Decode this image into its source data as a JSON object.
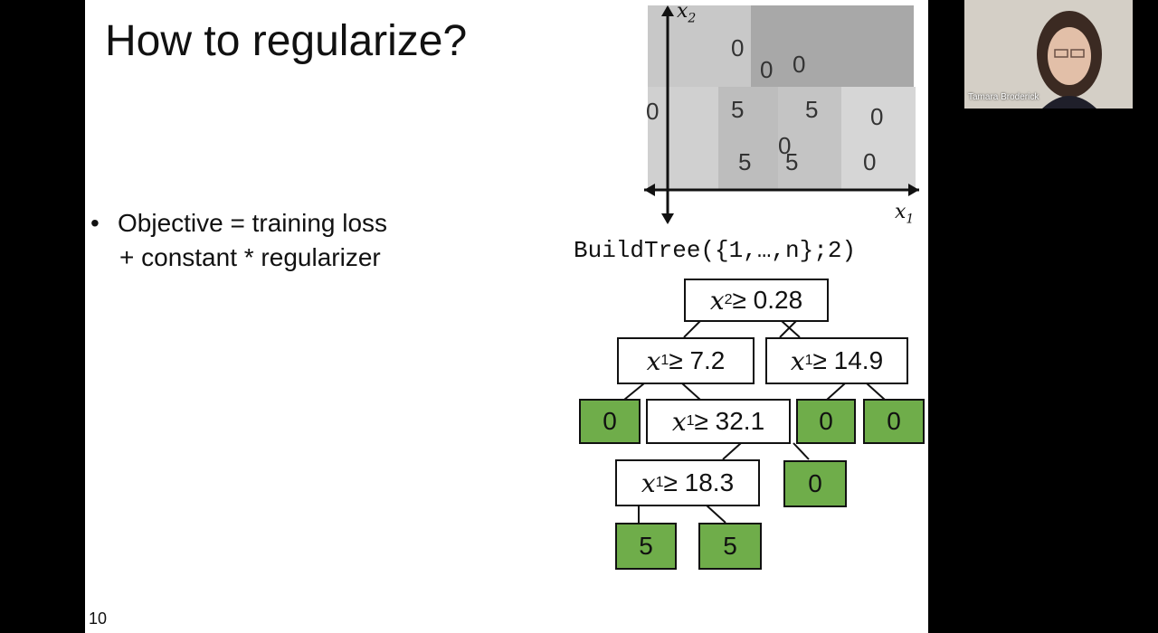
{
  "slide": {
    "title": "How to regularize?",
    "bullet": "•",
    "bullet_line1": "Objective = training loss",
    "bullet_line2": "+ constant * regularizer",
    "page_number": "10"
  },
  "plot": {
    "x_axis_label": "x",
    "x_axis_sub": "1",
    "y_axis_label": "x",
    "y_axis_sub": "2",
    "cells": [
      "0",
      "0",
      "0",
      "0",
      "5",
      "5",
      "0",
      "0",
      "5",
      "5",
      "0"
    ]
  },
  "tree": {
    "call": "BuildTree({1,…,n};2)",
    "root": {
      "var": "x",
      "sub": "2",
      "rest": " ≥ 0.28"
    },
    "n1": {
      "var": "x",
      "sub": "1",
      "rest": " ≥ 7.2"
    },
    "n2": {
      "var": "x",
      "sub": "1",
      "rest": " ≥ 14.9"
    },
    "n3": {
      "var": "x",
      "sub": "1",
      "rest": " ≥ 32.1"
    },
    "n4": {
      "var": "x",
      "sub": "1",
      "rest": " ≥ 18.3"
    },
    "leaves": [
      "0",
      "0",
      "0",
      "0",
      "5",
      "5"
    ],
    "leaf_color": "#6fad4a"
  },
  "video": {
    "participant_name": "Tamara Broderick"
  }
}
